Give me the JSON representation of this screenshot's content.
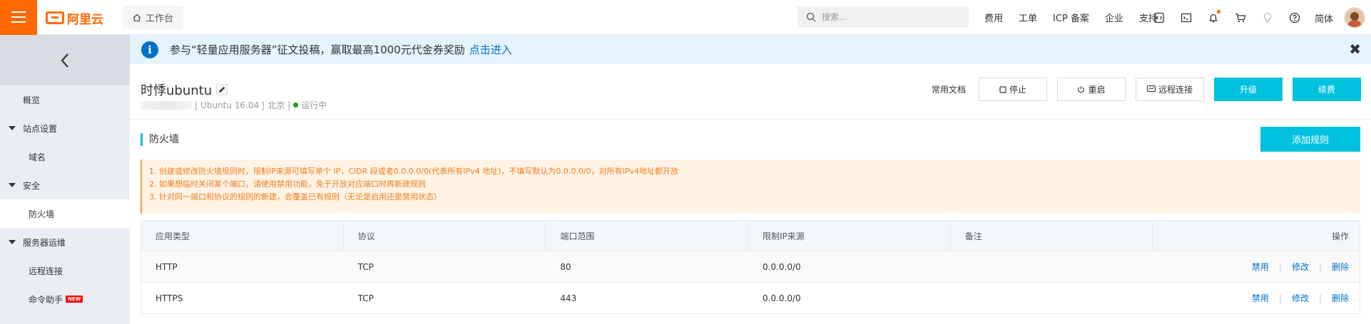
{
  "topbar": {
    "menu_icon": "hamburger-menu-icon",
    "logo_text": "阿里云",
    "workbench_label": "工作台",
    "search_placeholder": "搜索...",
    "links": [
      "费用",
      "工单",
      "ICP 备案",
      "企业",
      "支持"
    ],
    "icons": [
      "code-icon",
      "terminal-icon",
      "bell-icon",
      "cart-icon",
      "lightbulb-icon",
      "help-icon"
    ],
    "language": "简体"
  },
  "sidebar": {
    "back_icon": "chevron-left-icon",
    "items": [
      {
        "label": "概览",
        "type": "item"
      },
      {
        "label": "站点设置",
        "type": "group"
      },
      {
        "label": "域名",
        "type": "sub"
      },
      {
        "label": "安全",
        "type": "group"
      },
      {
        "label": "防火墙",
        "type": "sub",
        "active": true
      },
      {
        "label": "服务器运维",
        "type": "group"
      },
      {
        "label": "远程连接",
        "type": "sub"
      },
      {
        "label": "命令助手",
        "type": "sub",
        "badge": "NEW"
      }
    ]
  },
  "banner": {
    "text": "参与“轻量应用服务器”征文投稿，赢取最高1000元代金券奖励",
    "link": "点击进入",
    "close": "✖"
  },
  "instance": {
    "name": "时悸ubuntu",
    "os": "Ubuntu  16.04",
    "region": "北京",
    "status": "运行中",
    "status_color": "#1aa01a"
  },
  "actions": {
    "docs": "常用文档",
    "stop": "停止",
    "restart": "重启",
    "remote": "远程连接",
    "upgrade": "升级",
    "renew": "续费"
  },
  "firewall": {
    "title": "防火墙",
    "add_rule": "添加规则",
    "notices": [
      "1. 创建或修改防火墙规则时，限制IP来源可填写单个 IP，CIDR 段或者0.0.0.0/0(代表所有IPv4 地址)，不填写默认为0.0.0.0/0，对所有IPv4地址都开放",
      "2. 如果想临时关闭某个端口，请使用禁用功能，免于开放对应端口时再新建规则",
      "3. 针对同一端口和协议的规则的新建，会覆盖已有规则（无论是启用还是禁用状态）"
    ],
    "columns": [
      "应用类型",
      "协议",
      "端口范围",
      "限制IP来源",
      "备注",
      "操作"
    ],
    "rows": [
      {
        "app": "HTTP",
        "protocol": "TCP",
        "port": "80",
        "source": "0.0.0.0/0",
        "note": ""
      },
      {
        "app": "HTTPS",
        "protocol": "TCP",
        "port": "443",
        "source": "0.0.0.0/0",
        "note": ""
      }
    ],
    "ops": {
      "disable": "禁用",
      "edit": "修改",
      "delete": "删除",
      "sep": "|"
    }
  },
  "colors": {
    "brand": "#ff6a00",
    "accent": "#00c1de",
    "link": "#0070cc",
    "warning": "#f07e1e"
  }
}
